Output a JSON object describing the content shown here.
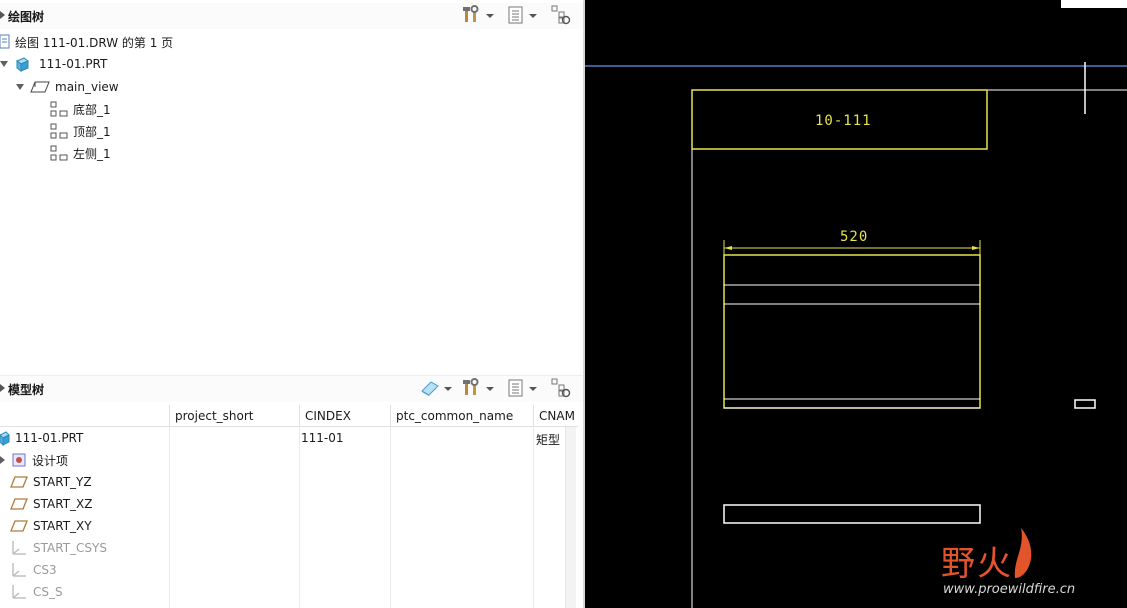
{
  "drawing_tree": {
    "title": "绘图树",
    "items": [
      {
        "label": "绘图 111-01.DRW 的第 1 页"
      },
      {
        "label": "111-01.PRT"
      },
      {
        "label": "main_view"
      },
      {
        "label": "底部_1"
      },
      {
        "label": "顶部_1"
      },
      {
        "label": "左侧_1"
      }
    ]
  },
  "model_tree": {
    "title": "模型树",
    "columns": [
      "project_short",
      "CINDEX",
      "ptc_common_name",
      "CNAM"
    ],
    "root": {
      "label": "111-01.PRT",
      "cindex": "111-01",
      "cname": "矩型"
    },
    "items": [
      {
        "label": "设计项"
      },
      {
        "label": "START_YZ"
      },
      {
        "label": "START_XZ"
      },
      {
        "label": "START_XY"
      },
      {
        "label": "START_CSYS"
      },
      {
        "label": "CS3"
      },
      {
        "label": "CS_S"
      }
    ]
  },
  "drawing": {
    "title_block_text": "10-111",
    "dimension_value": "520"
  },
  "watermark": {
    "logo_text": "野火",
    "url": "www.proewildfire.cn"
  },
  "colors": {
    "canvas_bg": "#000000",
    "drawing_yellow": "#e6e24a",
    "drawing_white": "#ffffff",
    "blue_line": "#4a80c8",
    "watermark_red": "#e2552a"
  }
}
